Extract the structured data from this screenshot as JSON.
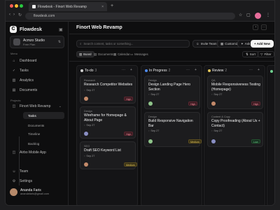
{
  "browser": {
    "tab_title": "Flowdesk - Finort Web Revamp",
    "url": "flowdesk.com",
    "colors": {
      "red": "#ff5f57",
      "yellow": "#febc2e",
      "green": "#28c840"
    }
  },
  "sidebar": {
    "brand": "Flowdesk",
    "workspace": {
      "name": "Acmzo Studio",
      "plan": "Free Plan"
    },
    "main_section": "Menu",
    "items": [
      {
        "label": "Dashboard",
        "icon": "home-icon"
      },
      {
        "label": "Tasks",
        "icon": "check-icon"
      },
      {
        "label": "Analytics",
        "icon": "chart-icon"
      },
      {
        "label": "Documents",
        "icon": "document-icon"
      }
    ],
    "projects_section": "Projects",
    "project": "Finort Web Revamp",
    "subitems": [
      "Tasks",
      "Documents",
      "Timeline",
      "Backlog"
    ],
    "project2": "Airbo Mobile App",
    "bottom": [
      {
        "label": "Team"
      },
      {
        "label": "Settings"
      }
    ],
    "user": {
      "name": "Ananda Faris",
      "email": "anandafaris@gmail.com"
    }
  },
  "main": {
    "title": "Finort Web Revamp",
    "search_placeholder": "Search content, tasks or something...",
    "actions": {
      "invite": "Invite Team",
      "customize": "Customize",
      "ask_ai": "Ask AI",
      "add_new": "+ Add New"
    },
    "view_tabs": [
      "Board",
      "Documents",
      "Calendar",
      "Messages"
    ],
    "sort": "Sort",
    "filter": "Filter"
  },
  "columns": [
    {
      "title": "To-do",
      "count": "3",
      "color": "#cfcfcf",
      "cards": [
        {
          "category": "Research",
          "title": "Research Competitor Websites",
          "date": "Sep 27",
          "priority": "High"
        },
        {
          "category": "Design",
          "title": "Wireframe for Homepage & About Page",
          "date": "Sep 27",
          "priority": "High"
        },
        {
          "category": "SEO",
          "title": "Draft SEO Keyword List",
          "date": "Sep 27",
          "priority": "Medium"
        }
      ]
    },
    {
      "title": "In Progress",
      "count": "2",
      "color": "#4f8bf0",
      "cards": [
        {
          "category": "Design",
          "title": "Design Landing Page Hero Section",
          "date": "Sep 27",
          "priority": "High"
        },
        {
          "category": "Design",
          "title": "Build Responsive Navigation Bar",
          "date": "Sep 27",
          "priority": "Medium"
        }
      ]
    },
    {
      "title": "Review",
      "count": "2",
      "color": "#e4c85a",
      "cards": [
        {
          "category": "QA",
          "title": "Mobile Responsiveness Testing (Homepage)",
          "date": "Sep 27",
          "priority": "High"
        },
        {
          "category": "Content & Copy",
          "title": "Copy Proofreading (About Us + Contact)",
          "date": "Sep 27",
          "priority": "Low"
        }
      ]
    }
  ]
}
